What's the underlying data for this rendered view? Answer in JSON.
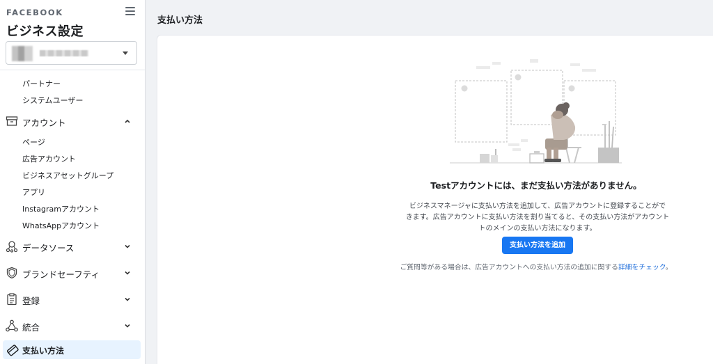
{
  "sidebar": {
    "brand": "FACEBOOK",
    "app_title": "ビジネス設定",
    "menu_icon": "hamburger-icon",
    "sub_items_top": [
      {
        "label": "パートナー"
      },
      {
        "label": "システムユーザー"
      }
    ],
    "accounts_section": {
      "label": "アカウント",
      "icon": "archive-box-icon",
      "expanded": true,
      "items": [
        {
          "label": "ページ"
        },
        {
          "label": "広告アカウント"
        },
        {
          "label": "ビジネスアセットグループ"
        },
        {
          "label": "アプリ"
        },
        {
          "label": "Instagramアカウント"
        },
        {
          "label": "WhatsAppアカウント"
        }
      ]
    },
    "sections": [
      {
        "label": "データソース",
        "icon": "data-source-icon"
      },
      {
        "label": "ブランドセーフティ",
        "icon": "shield-icon"
      },
      {
        "label": "登録",
        "icon": "clipboard-icon"
      },
      {
        "label": "統合",
        "icon": "integration-icon"
      }
    ],
    "active_item": {
      "label": "支払い方法",
      "icon": "credit-card-icon"
    }
  },
  "main": {
    "page_title": "支払い方法",
    "empty_state": {
      "title": "Testアカウントには、まだ支払い方法がありません。",
      "description_lines": [
        "ビジネスマネージャに支払い方法を追加して、広告アカウントに登録することがで",
        "きます。広告アカウントに支払い方法を割り当てると、その支払い方法がアカウント",
        "トのメインの支払い方法になります。"
      ],
      "button_label": "支払い方法を追加",
      "help_prefix": "ご質問等がある場合は、広告アカウントへの支払い方法の追加に関する",
      "help_link": "詳細をチェック",
      "help_suffix": "。"
    }
  },
  "colors": {
    "accent": "#1877f2",
    "active_bg": "#e7f3ff",
    "link": "#216fdb",
    "page_bg": "#f0f2f5"
  }
}
